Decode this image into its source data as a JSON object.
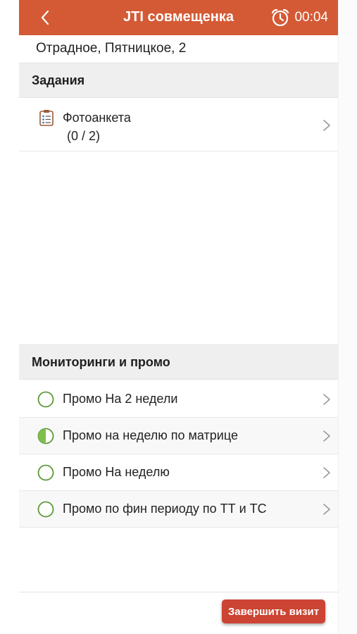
{
  "header": {
    "title": "JTI совмещенка",
    "timer": "00:04",
    "back_icon": "chevron-left-icon",
    "timer_icon": "alarm-clock-icon"
  },
  "address": "Отрадное, Пятницкое, 2",
  "tasks": {
    "section_title": "Задания",
    "items": [
      {
        "title": "Фотоанкета",
        "count": "(0 / 2)",
        "icon": "clipboard-icon"
      }
    ]
  },
  "monitorings": {
    "section_title": "Мониторинги и промо",
    "items": [
      {
        "label": "Промо На 2 недели",
        "status": "empty"
      },
      {
        "label": "Промо на неделю по матрице",
        "status": "half"
      },
      {
        "label": "Промо На неделю",
        "status": "empty"
      },
      {
        "label": "Промо по фин периоду по ТТ и ТС",
        "status": "empty"
      }
    ]
  },
  "footer": {
    "finish_button": "Завершить визит"
  },
  "colors": {
    "accent": "#d45a35",
    "status_green": "#5e9a3a",
    "button": "#cc4433"
  }
}
